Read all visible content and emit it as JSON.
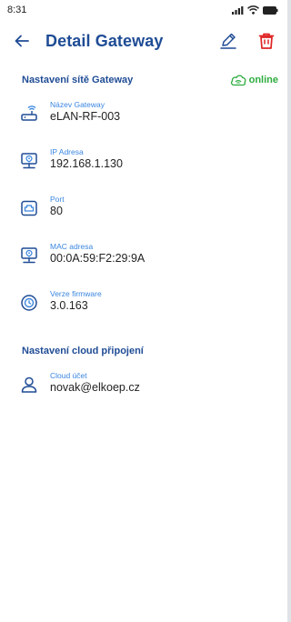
{
  "status": {
    "time": "8:31",
    "icons": [
      "signal-icon",
      "wifi-icon",
      "battery-icon"
    ]
  },
  "appbar": {
    "title": "Detail Gateway",
    "back_icon": "arrow-left-icon",
    "edit_icon": "pencil-icon",
    "delete_icon": "trash-icon"
  },
  "network_section": {
    "title": "Nastavení sítě Gateway",
    "status": "online",
    "status_color": "#2dac3e",
    "rows": [
      {
        "label": "Název Gateway",
        "value": "eLAN-RF-003",
        "icon": "router-icon"
      },
      {
        "label": "IP Adresa",
        "value": "192.168.1.130",
        "icon": "network-monitor-icon"
      },
      {
        "label": "Port",
        "value": "80",
        "icon": "port-icon"
      },
      {
        "label": "MAC adresa",
        "value": "00:0A:59:F2:29:9A",
        "icon": "network-monitor-icon"
      },
      {
        "label": "Verze firmware",
        "value": "3.0.163",
        "icon": "firmware-icon"
      }
    ]
  },
  "cloud_section": {
    "title": "Nastavení cloud připojení",
    "rows": [
      {
        "label": "Cloud účet",
        "value": "novak@elkoep.cz",
        "icon": "user-icon"
      }
    ]
  },
  "colors": {
    "primary": "#1f4c95",
    "accent": "#3a86e0",
    "delete": "#e02424",
    "online": "#2dac3e"
  }
}
